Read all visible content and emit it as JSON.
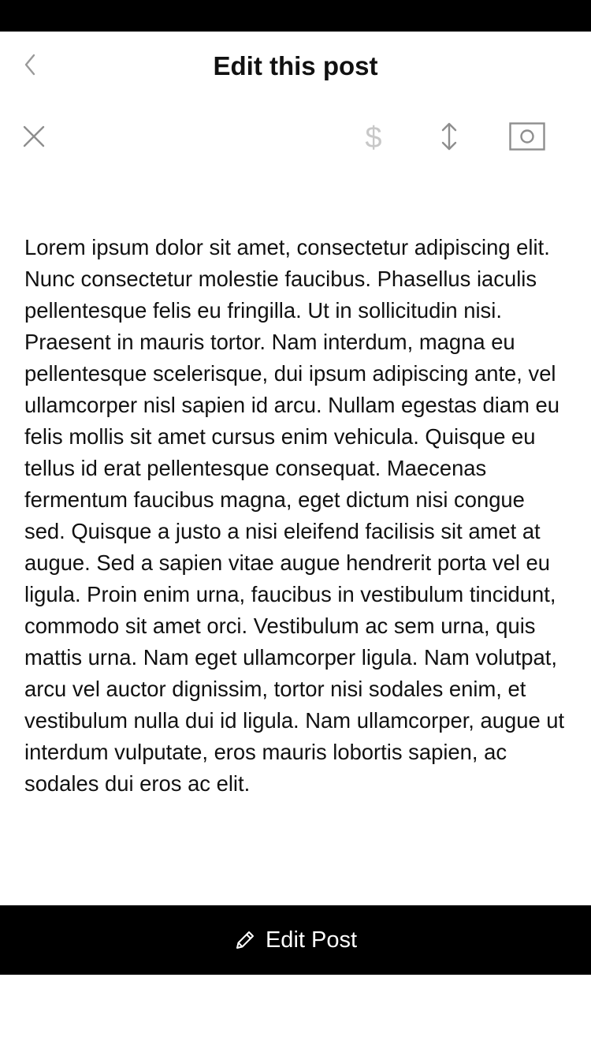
{
  "nav": {
    "title": "Edit this post",
    "back_icon": "chevron-left-icon"
  },
  "toolbar": {
    "close_icon": "close-icon",
    "price_icon": "dollar-icon",
    "price_glyph": "$",
    "resize_icon": "vertical-resize-icon",
    "photo_icon": "camera-icon"
  },
  "post": {
    "body": "Lorem ipsum dolor sit amet, consectetur adipiscing elit. Nunc consectetur molestie faucibus. Phasellus iaculis pellentesque felis eu fringilla. Ut in sollicitudin nisi. Praesent in mauris tortor. Nam interdum, magna eu pellentesque scelerisque, dui ipsum adipiscing ante, vel ullamcorper nisl sapien id arcu. Nullam egestas diam eu felis mollis sit amet cursus enim vehicula. Quisque eu tellus id erat pellentesque consequat. Maecenas fermentum faucibus magna, eget dictum nisi congue sed. Quisque a justo a nisi eleifend facilisis sit amet at augue. Sed a sapien vitae augue hendrerit porta vel eu ligula. Proin enim urna, faucibus in vestibulum tincidunt, commodo sit amet orci. Vestibulum ac sem urna, quis mattis urna. Nam eget ullamcorper ligula. Nam volutpat, arcu vel auctor dignissim, tortor nisi sodales enim, et vestibulum nulla dui id ligula. Nam ullamcorper, augue ut interdum vulputate, eros mauris lobortis sapien, ac sodales dui eros ac elit."
  },
  "action": {
    "edit_label": "Edit Post",
    "edit_icon": "pencil-icon"
  },
  "colors": {
    "status_bar": "#000000",
    "action_bar": "#000000",
    "icon_gray": "#8e8e8e",
    "icon_light": "#c8c8c8",
    "text": "#111111"
  }
}
